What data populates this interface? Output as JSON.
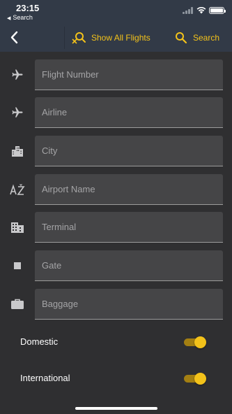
{
  "status_bar": {
    "time": "23:15",
    "back_app": "Search"
  },
  "nav": {
    "show_all_label": "Show All Flights",
    "search_label": "Search"
  },
  "fields": [
    {
      "id": "flight-number",
      "placeholder": "Flight Number",
      "value": "",
      "icon": "plane-icon"
    },
    {
      "id": "airline",
      "placeholder": "Airline",
      "value": "",
      "icon": "plane-icon"
    },
    {
      "id": "city",
      "placeholder": "City",
      "value": "",
      "icon": "city-buildings-icon"
    },
    {
      "id": "airport-name",
      "placeholder": "Airport Name",
      "value": "",
      "icon": "sort-alpha-icon"
    },
    {
      "id": "terminal",
      "placeholder": "Terminal",
      "value": "",
      "icon": "terminal-building-icon"
    },
    {
      "id": "gate",
      "placeholder": "Gate",
      "value": "",
      "icon": "gate-square-icon"
    },
    {
      "id": "baggage",
      "placeholder": "Baggage",
      "value": "",
      "icon": "briefcase-icon"
    }
  ],
  "toggles": [
    {
      "id": "domestic",
      "label": "Domestic",
      "on": true
    },
    {
      "id": "international",
      "label": "International",
      "on": true
    }
  ],
  "colors": {
    "accent": "#f3c21a",
    "nav_background": "#323a47",
    "background": "#2f2f31",
    "field_background": "#454547"
  }
}
